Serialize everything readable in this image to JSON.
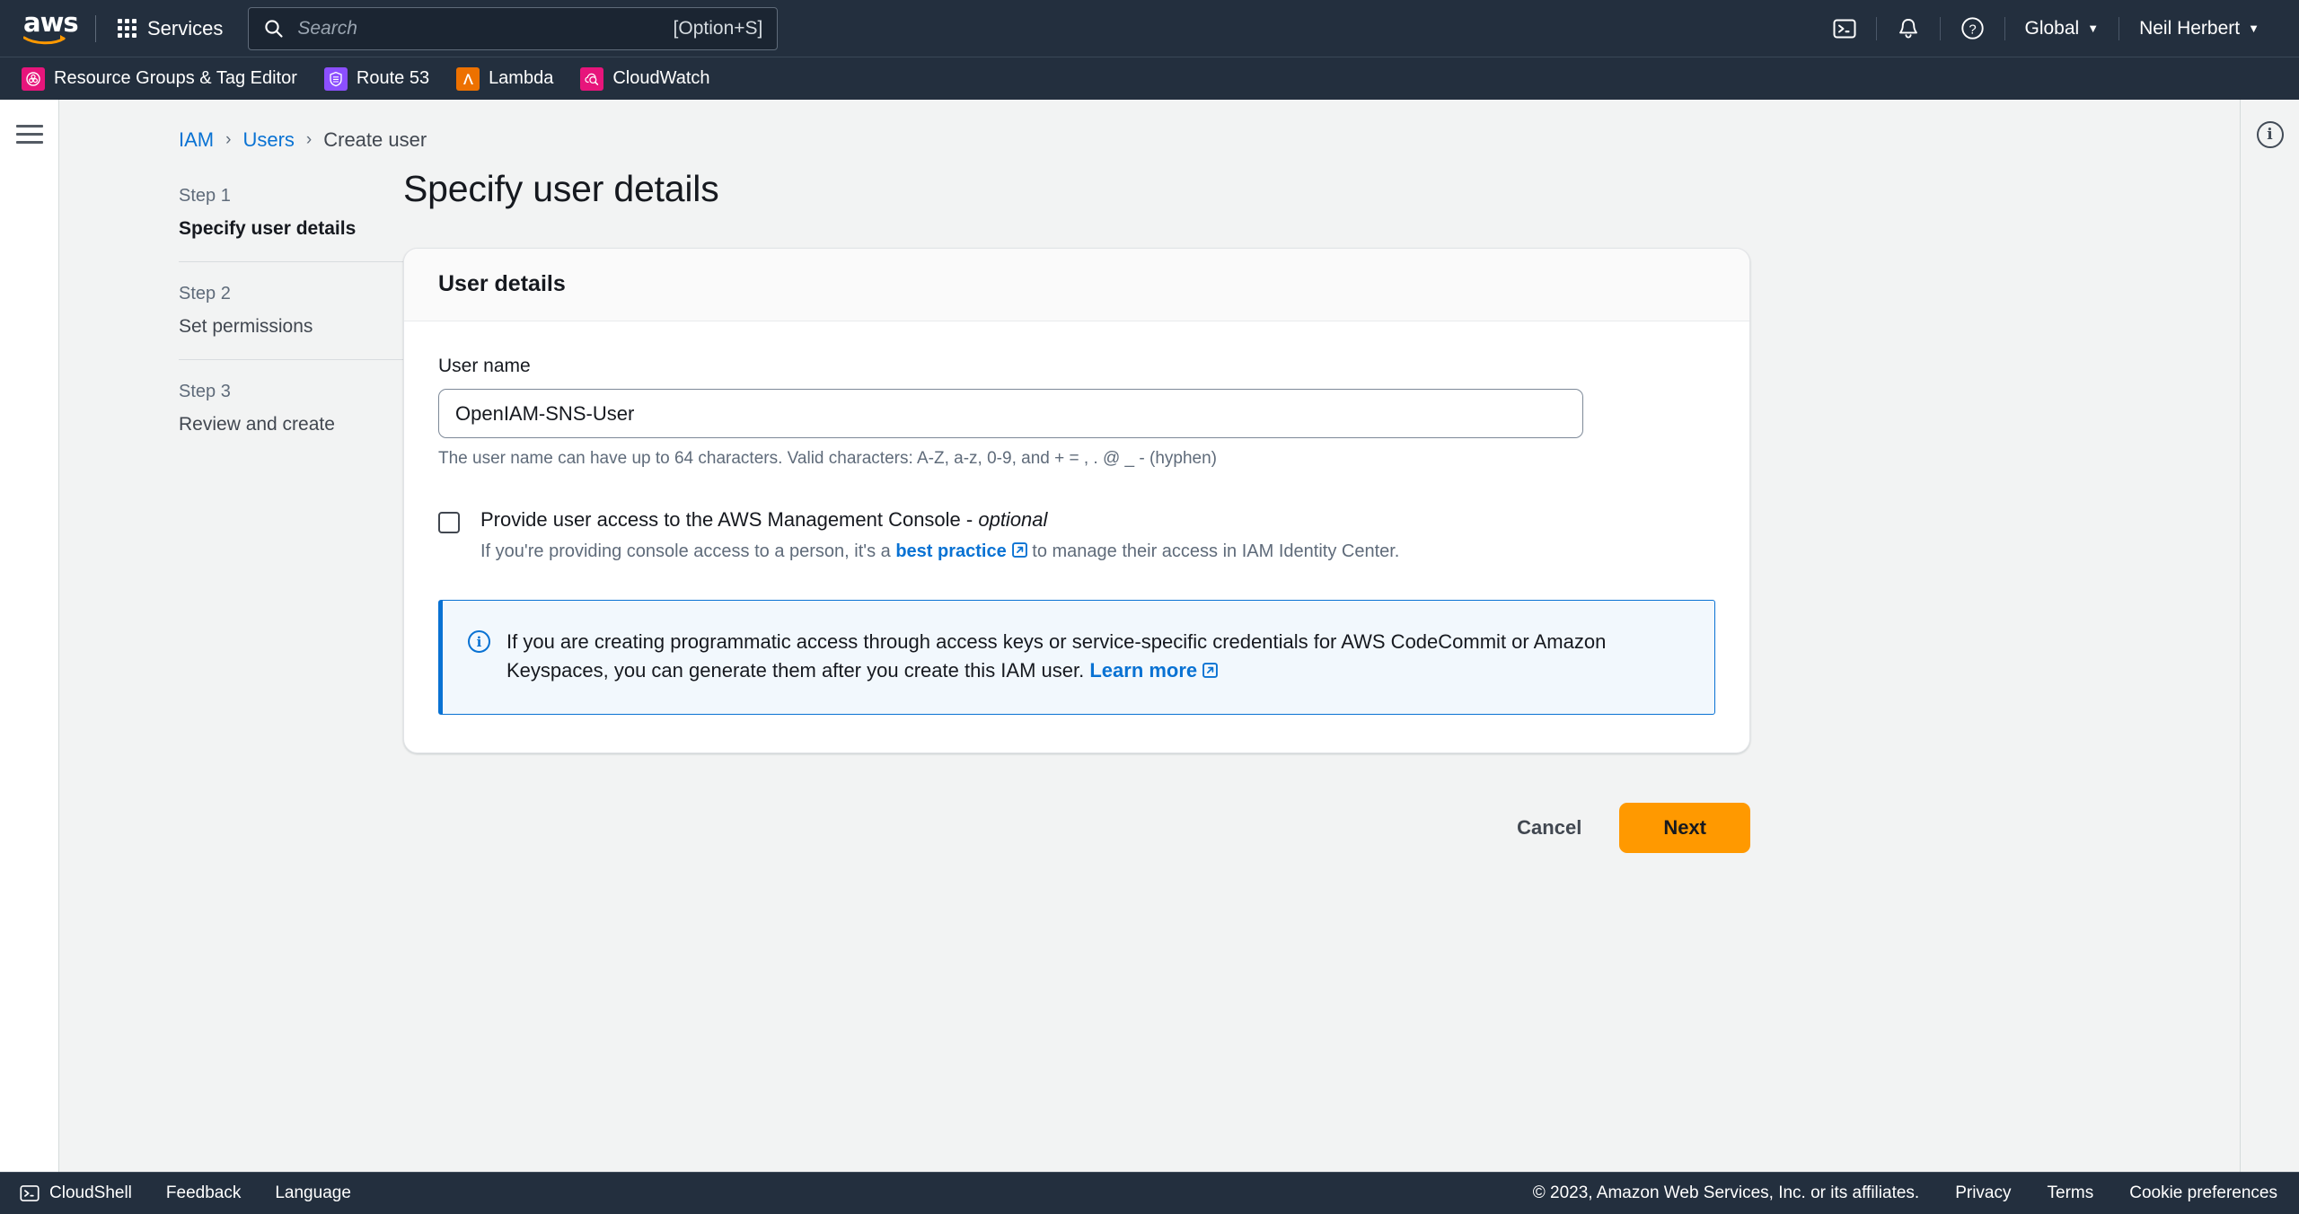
{
  "topnav": {
    "logo_alt": "aws",
    "services_label": "Services",
    "search": {
      "placeholder": "Search",
      "value": "",
      "shortcut": "[Option+S]",
      "icon": "search-icon"
    },
    "cloudshell_icon": "cloudshell-icon",
    "notifications_icon": "bell-icon",
    "help_icon": "question-circle-icon",
    "region_label": "Global",
    "account_label": "Neil Herbert",
    "caret": "▼"
  },
  "shortcuts": [
    {
      "label": "Resource Groups & Tag Editor",
      "icon": "resource-groups-icon",
      "color": "#e7157b"
    },
    {
      "label": "Route 53",
      "icon": "route53-icon",
      "color": "#8c4fff"
    },
    {
      "label": "Lambda",
      "icon": "lambda-icon",
      "color": "#ed7100"
    },
    {
      "label": "CloudWatch",
      "icon": "cloudwatch-icon",
      "color": "#e7157b"
    }
  ],
  "rail": {
    "menu_icon": "hamburger-menu-icon"
  },
  "info_panel": {
    "icon": "info-circle-icon",
    "glyph": "i"
  },
  "breadcrumb": [
    {
      "label": "IAM",
      "link": true
    },
    {
      "label": "Users",
      "link": true
    },
    {
      "label": "Create user",
      "link": false
    }
  ],
  "breadcrumb_separator": "›",
  "steps": [
    {
      "number": "Step 1",
      "title": "Specify user details",
      "active": true
    },
    {
      "number": "Step 2",
      "title": "Set permissions",
      "active": false
    },
    {
      "number": "Step 3",
      "title": "Review and create",
      "active": false
    }
  ],
  "page_title": "Specify user details",
  "card": {
    "header": "User details",
    "username": {
      "label": "User name",
      "value": "OpenIAM-SNS-User",
      "placeholder": "",
      "helper": "The user name can have up to 64 characters. Valid characters: A-Z, a-z, 0-9, and + = , . @ _ - (hyphen)"
    },
    "console_access": {
      "checked": false,
      "label_main": "Provide user access to the AWS Management Console - ",
      "label_optional": "optional",
      "sub_prefix": "If you're providing console access to a person, it's a ",
      "sub_link": "best practice",
      "sub_suffix": " to manage their access in IAM Identity Center.",
      "external_icon": "external-link-icon"
    },
    "alert": {
      "icon": "info-circle-icon",
      "glyph": "i",
      "text": "If you are creating programmatic access through access keys or service-specific credentials for AWS CodeCommit or Amazon Keyspaces, you can generate them after you create this IAM user. ",
      "link": "Learn more",
      "external_icon": "external-link-icon",
      "accent_color": "#0972d3",
      "background_color": "#f2f8fd"
    }
  },
  "actions": {
    "cancel_label": "Cancel",
    "next_label": "Next",
    "next_color": "#ff9900"
  },
  "footer": {
    "cloudshell_label": "CloudShell",
    "cloudshell_icon": "cloudshell-icon",
    "feedback_label": "Feedback",
    "language_label": "Language",
    "copyright": "© 2023, Amazon Web Services, Inc. or its affiliates.",
    "privacy_label": "Privacy",
    "terms_label": "Terms",
    "cookie_label": "Cookie preferences"
  }
}
